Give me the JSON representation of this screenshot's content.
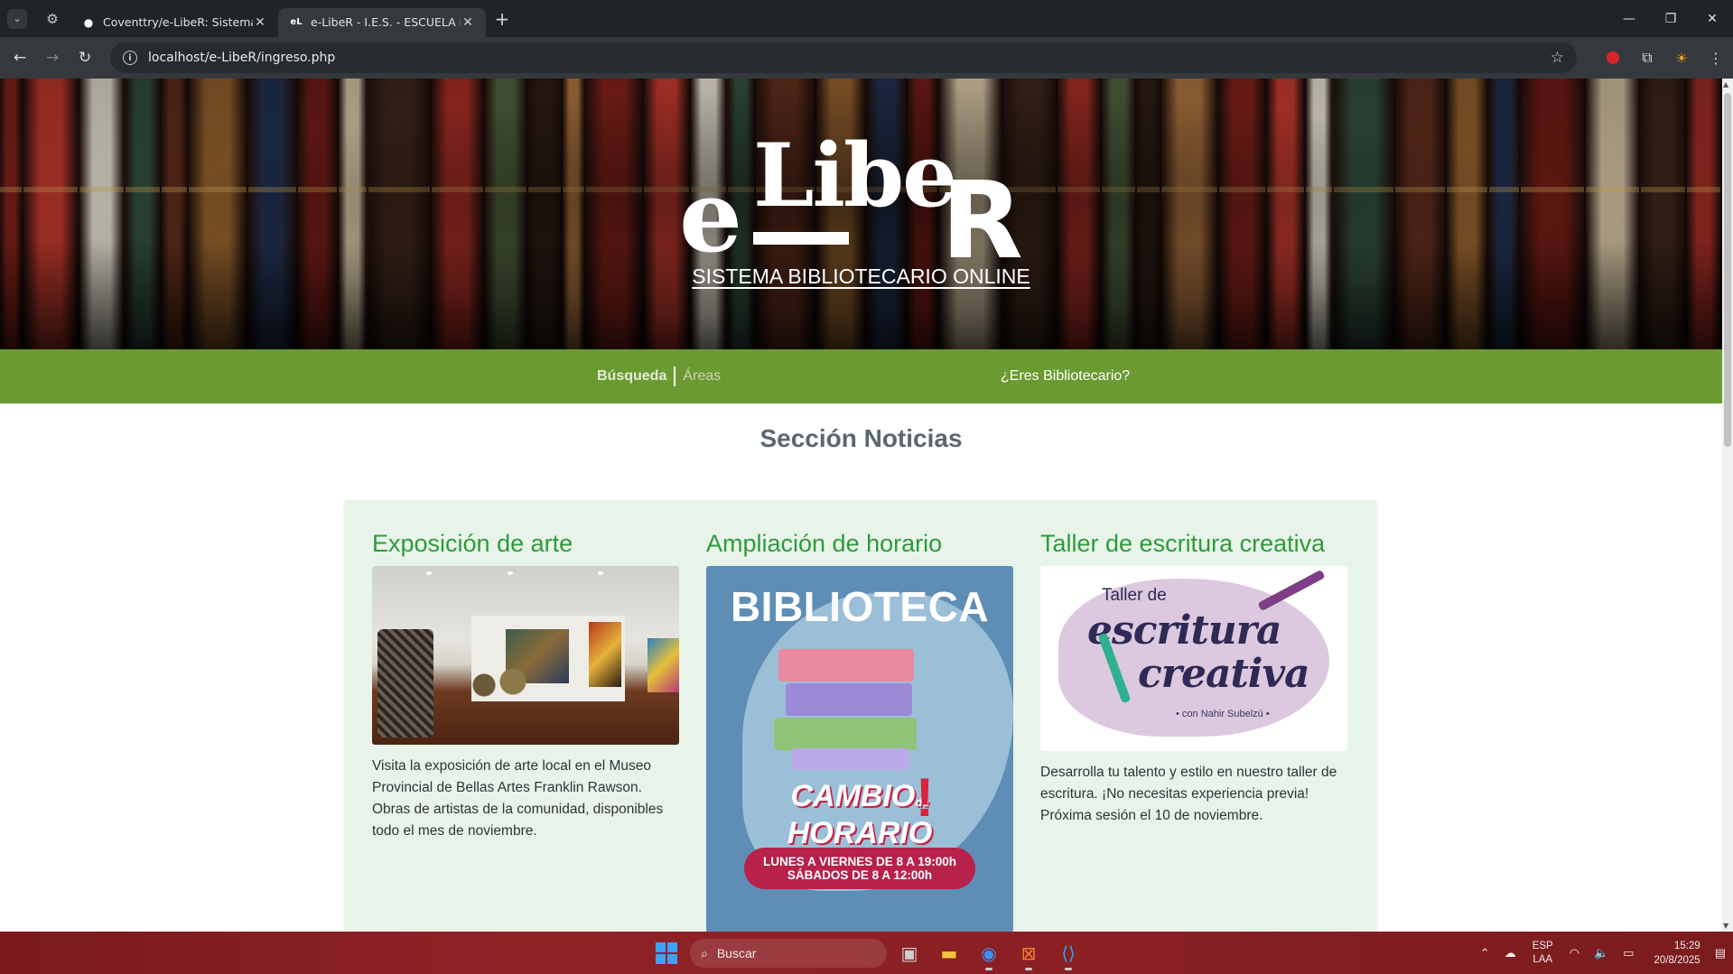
{
  "browser": {
    "tabs": [
      {
        "title": "Coventtry/e-LibeR: Sistema de",
        "active": false
      },
      {
        "title": "e-LibeR - I.E.S. - ESCUELA NOR",
        "active": true
      }
    ],
    "url": "localhost/e-LibeR/ingreso.php"
  },
  "hero": {
    "logo_e": "e",
    "logo_libe": "Libe",
    "logo_r": "R",
    "subtitle": "SISTEMA BIBLIOTECARIO ONLINE"
  },
  "nav": {
    "busqueda": "Búsqueda",
    "areas": "Áreas",
    "bibliotecario": "¿Eres Bibliotecario?"
  },
  "section_title": "Sección Noticias",
  "news": [
    {
      "title": "Exposición de arte",
      "body": "Visita la exposición de arte local en el Museo Provincial de Bellas Artes Franklin Rawson. Obras de artistas de la comunidad, disponibles todo el mes de noviembre."
    },
    {
      "title": "Ampliación de horario",
      "poster": {
        "heading": "BIBLIOTECA",
        "cambio": "CAMBIO",
        "de": "de",
        "horario": "HORARIO",
        "line1": "LUNES A VIERNES DE 8 A 19:00h",
        "line2": "SÁBADOS DE 8 A 12:00h"
      }
    },
    {
      "title": "Taller de escritura creativa",
      "image": {
        "line1": "Taller de",
        "line2": "escritura",
        "line3": "creativa",
        "credit": "• con Nahir Subelzú •"
      },
      "body": "Desarrolla tu talento y estilo en nuestro taller de escritura. ¡No necesitas experiencia previa! Próxima sesión el 10 de noviembre."
    }
  ],
  "taskbar": {
    "search_placeholder": "Buscar",
    "lang1": "ESP",
    "lang2": "LAA",
    "time": "15:29",
    "date": "20/8/2025"
  },
  "colors": {
    "nav_green": "#6a9a31",
    "news_title_green": "#2f9a3b",
    "panel_bg": "#e8f4e9"
  }
}
